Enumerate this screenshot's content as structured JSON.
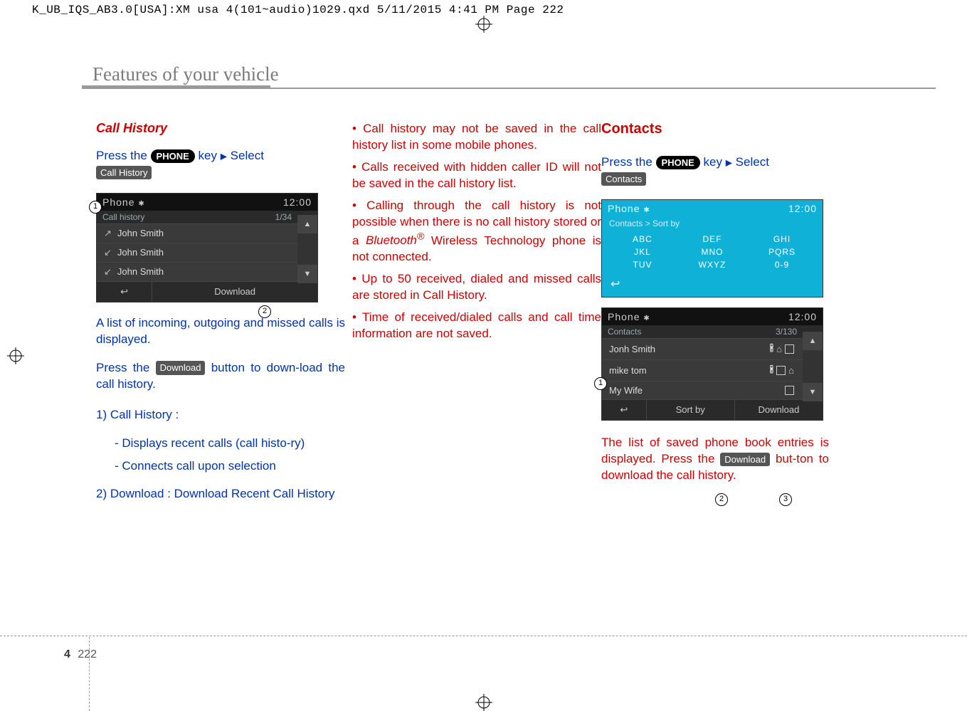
{
  "header_line": "K_UB_IQS_AB3.0[USA]:XM usa 4(101~audio)1029.qxd  5/11/2015  4:41 PM  Page 222",
  "section_title": "Features of your vehicle",
  "page": {
    "chapter": "4",
    "num": "222"
  },
  "col1": {
    "h": "Call History",
    "press_1a": "Press the ",
    "key_phone": "PHONE",
    "press_1b": " key   ",
    "press_1c": "   Select",
    "btn_callhistory": "Call History",
    "shot": {
      "title": "Phone",
      "time": "12:00",
      "sub": "Call history",
      "count": "1/34",
      "rows": [
        "John Smith",
        "John Smith",
        "John Smith"
      ],
      "back": "↩",
      "download": "Download"
    },
    "para1a": "A list of incoming, outgoing and missed calls is displayed.",
    "para1b_pre": "Press the ",
    "btn_download": "Download",
    "para1b_post": " button to down-load the call history.",
    "item1_h": "1) Call History :",
    "item1_a": "- Displays recent calls (call histo-ry)",
    "item1_b": "- Connects call upon selection",
    "item2": "2) Download : Download Recent Call History"
  },
  "col2": {
    "b1": "Call history may not be saved in the call history list in some mobile phones.",
    "b2": "Calls received with hidden caller ID will not be saved in the call history list.",
    "b3_pre": "Calling through the call history is not possible when there is no call history stored or a ",
    "b3_bt": "Bluetooth",
    "b3_post": " Wireless Technology phone is not connected.",
    "b4": "Up to 50 received, dialed and missed calls are stored in Call History.",
    "b5": "Time of received/dialed calls and call time information are not saved."
  },
  "col3": {
    "h": "Contacts",
    "press_1a": "Press the ",
    "key_phone": "PHONE",
    "press_1b": " key ",
    "press_1c": " Select",
    "btn_contacts": "Contacts",
    "shot_sort": {
      "title": "Phone",
      "time": "12:00",
      "sub": "Contacts > Sort by",
      "grid": [
        "ABC",
        "DEF",
        "GHI",
        "JKL",
        "MNO",
        "PQRS",
        "TUV",
        "WXYZ",
        "0-9"
      ],
      "back": "↩"
    },
    "shot_list": {
      "title": "Phone",
      "time": "12:00",
      "sub": "Contacts",
      "count": "3/130",
      "rows": [
        "Jonh Smith",
        "mike tom",
        "My Wife"
      ],
      "back": "↩",
      "sortby": "Sort by",
      "download": "Download"
    },
    "para_pre": "The list of saved phone book entries is displayed. Press the ",
    "btn_download": "Download",
    "para_post": " but-ton to download the call history."
  },
  "callouts": {
    "one": "1",
    "two": "2",
    "three": "3"
  }
}
